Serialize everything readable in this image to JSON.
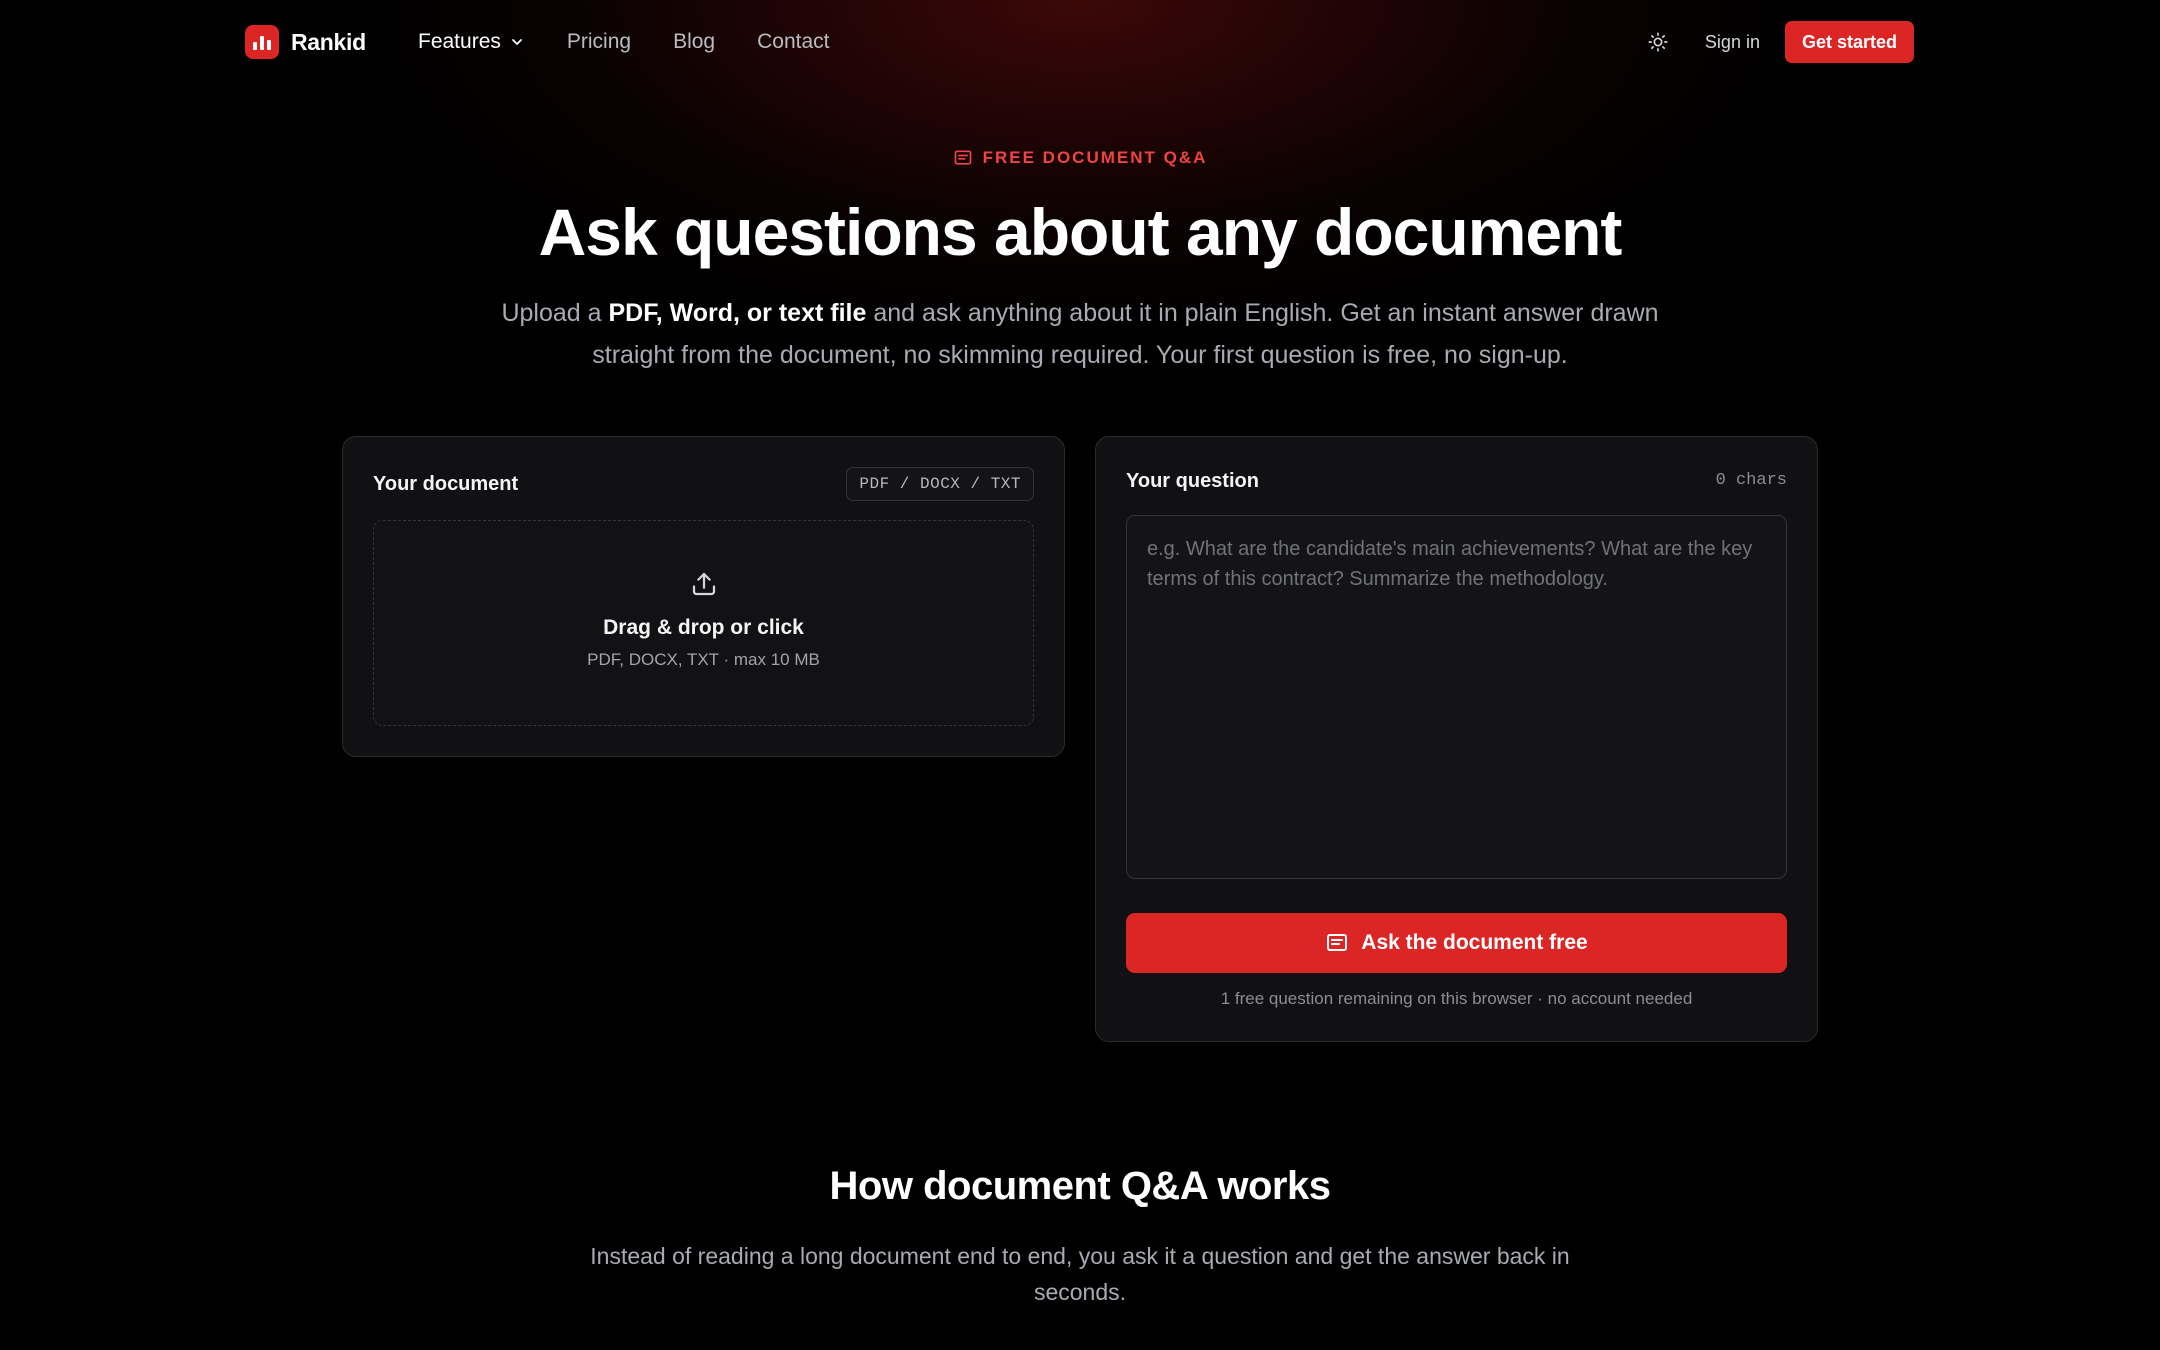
{
  "nav": {
    "brand": "Rankid",
    "links": [
      {
        "label": "Features",
        "has_dropdown": true
      },
      {
        "label": "Pricing"
      },
      {
        "label": "Blog"
      },
      {
        "label": "Contact"
      }
    ],
    "theme_toggle_icon": "sun-icon",
    "signin_label": "Sign in",
    "cta_label": "Get started"
  },
  "hero": {
    "eyebrow": "FREE DOCUMENT Q&A",
    "title": "Ask questions about any document",
    "subtitle_pre": "Upload a ",
    "subtitle_bold": "PDF, Word, or text file",
    "subtitle_post": " and ask anything about it in plain English. Get an instant answer drawn straight from the document, no skimming required. Your first question is free, no sign-up."
  },
  "document_card": {
    "label": "Your document",
    "badge": "PDF / DOCX / TXT",
    "dropzone_title": "Drag & drop or click",
    "dropzone_sub": "PDF, DOCX, TXT · max 10 MB"
  },
  "question_card": {
    "label": "Your question",
    "char_count": "0 chars",
    "input_value": "",
    "input_placeholder": "e.g. What are the candidate's main achievements? What are the key terms of this contract? Summarize the methodology.",
    "ask_label": "Ask the document free",
    "note": "1 free question remaining on this browser · no account needed"
  },
  "how": {
    "title": "How document Q&A works",
    "subtitle": "Instead of reading a long document end to end, you ask it a question and get the answer back in seconds."
  },
  "colors": {
    "accent": "#dc2626",
    "background": "#000000",
    "card": "#111113"
  }
}
